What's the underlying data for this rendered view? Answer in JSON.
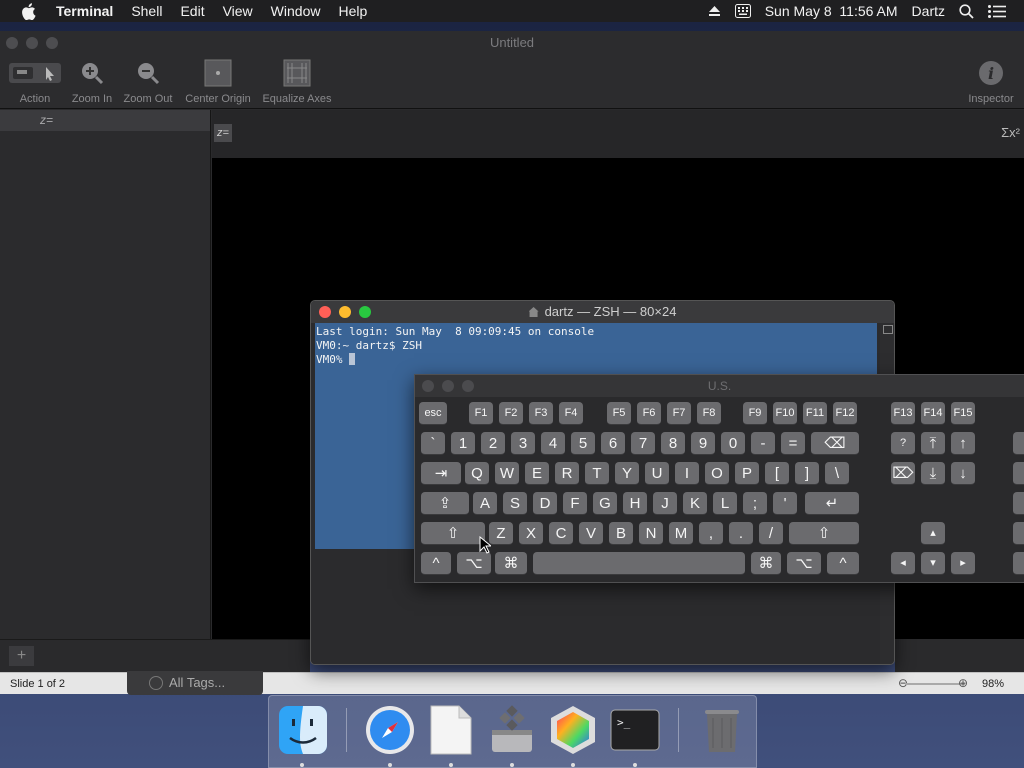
{
  "menubar": {
    "app_name": "Terminal",
    "menus": [
      "Shell",
      "Edit",
      "View",
      "Window",
      "Help"
    ],
    "clock": "Sun May 8  11:56 AM",
    "user": "Dartz"
  },
  "grapher": {
    "title": "Untitled",
    "toolbar": {
      "action": "Action",
      "zoom_in": "Zoom In",
      "zoom_out": "Zoom Out",
      "center_origin": "Center Origin",
      "equalize_axes": "Equalize Axes",
      "inspector": "Inspector"
    },
    "sidebar_equation": "z=",
    "equation_icon": "z=",
    "sigma_glyph": "Σx²"
  },
  "status": {
    "slide": "Slide 1 of 2",
    "zoom": "98%",
    "tags": "All Tags..."
  },
  "terminal": {
    "title": "dartz — ZSH — 80×24",
    "lines": [
      "Last login: Sun May  8 09:09:45 on console",
      "VM0:~ dartz$ ZSH",
      "VM0% "
    ]
  },
  "keyboard": {
    "title": "U.S.",
    "fn_row": [
      "esc",
      "F1",
      "F2",
      "F3",
      "F4",
      "F5",
      "F6",
      "F7",
      "F8",
      "F9",
      "F10",
      "F11",
      "F12",
      "F13",
      "F14",
      "F15"
    ],
    "number_row": [
      "`",
      "1",
      "2",
      "3",
      "4",
      "5",
      "6",
      "7",
      "8",
      "9",
      "0",
      "-",
      "="
    ],
    "qwerty_row": [
      "Q",
      "W",
      "E",
      "R",
      "T",
      "Y",
      "U",
      "I",
      "O",
      "P",
      "[",
      "]",
      "\\"
    ],
    "home_row": [
      "A",
      "S",
      "D",
      "F",
      "G",
      "H",
      "J",
      "K",
      "L",
      ";",
      "'"
    ],
    "bottom_row": [
      "Z",
      "X",
      "C",
      "V",
      "B",
      "N",
      "M",
      ",",
      ".",
      "/"
    ],
    "symbols": {
      "backspace": "⌫",
      "tab": "⇥",
      "caps": "⇪",
      "return": "↵",
      "shift": "⇧",
      "ctrl": "^",
      "option": "⌥",
      "command": "⌘",
      "help": "?",
      "home": "⤒",
      "pgup": "↑",
      "fwd_delete": "⌦",
      "end": "⤓",
      "pgdn": "↓",
      "arrow_up": "▴",
      "arrow_left": "◂",
      "arrow_down": "▾",
      "arrow_right": "▸"
    }
  },
  "dock": {
    "apps": [
      "finder-icon",
      "safari-icon",
      "textedit-icon",
      "bootcamp-icon",
      "grapher-icon",
      "terminal-icon",
      "trash-icon"
    ],
    "terminal_prompt": ">_"
  }
}
